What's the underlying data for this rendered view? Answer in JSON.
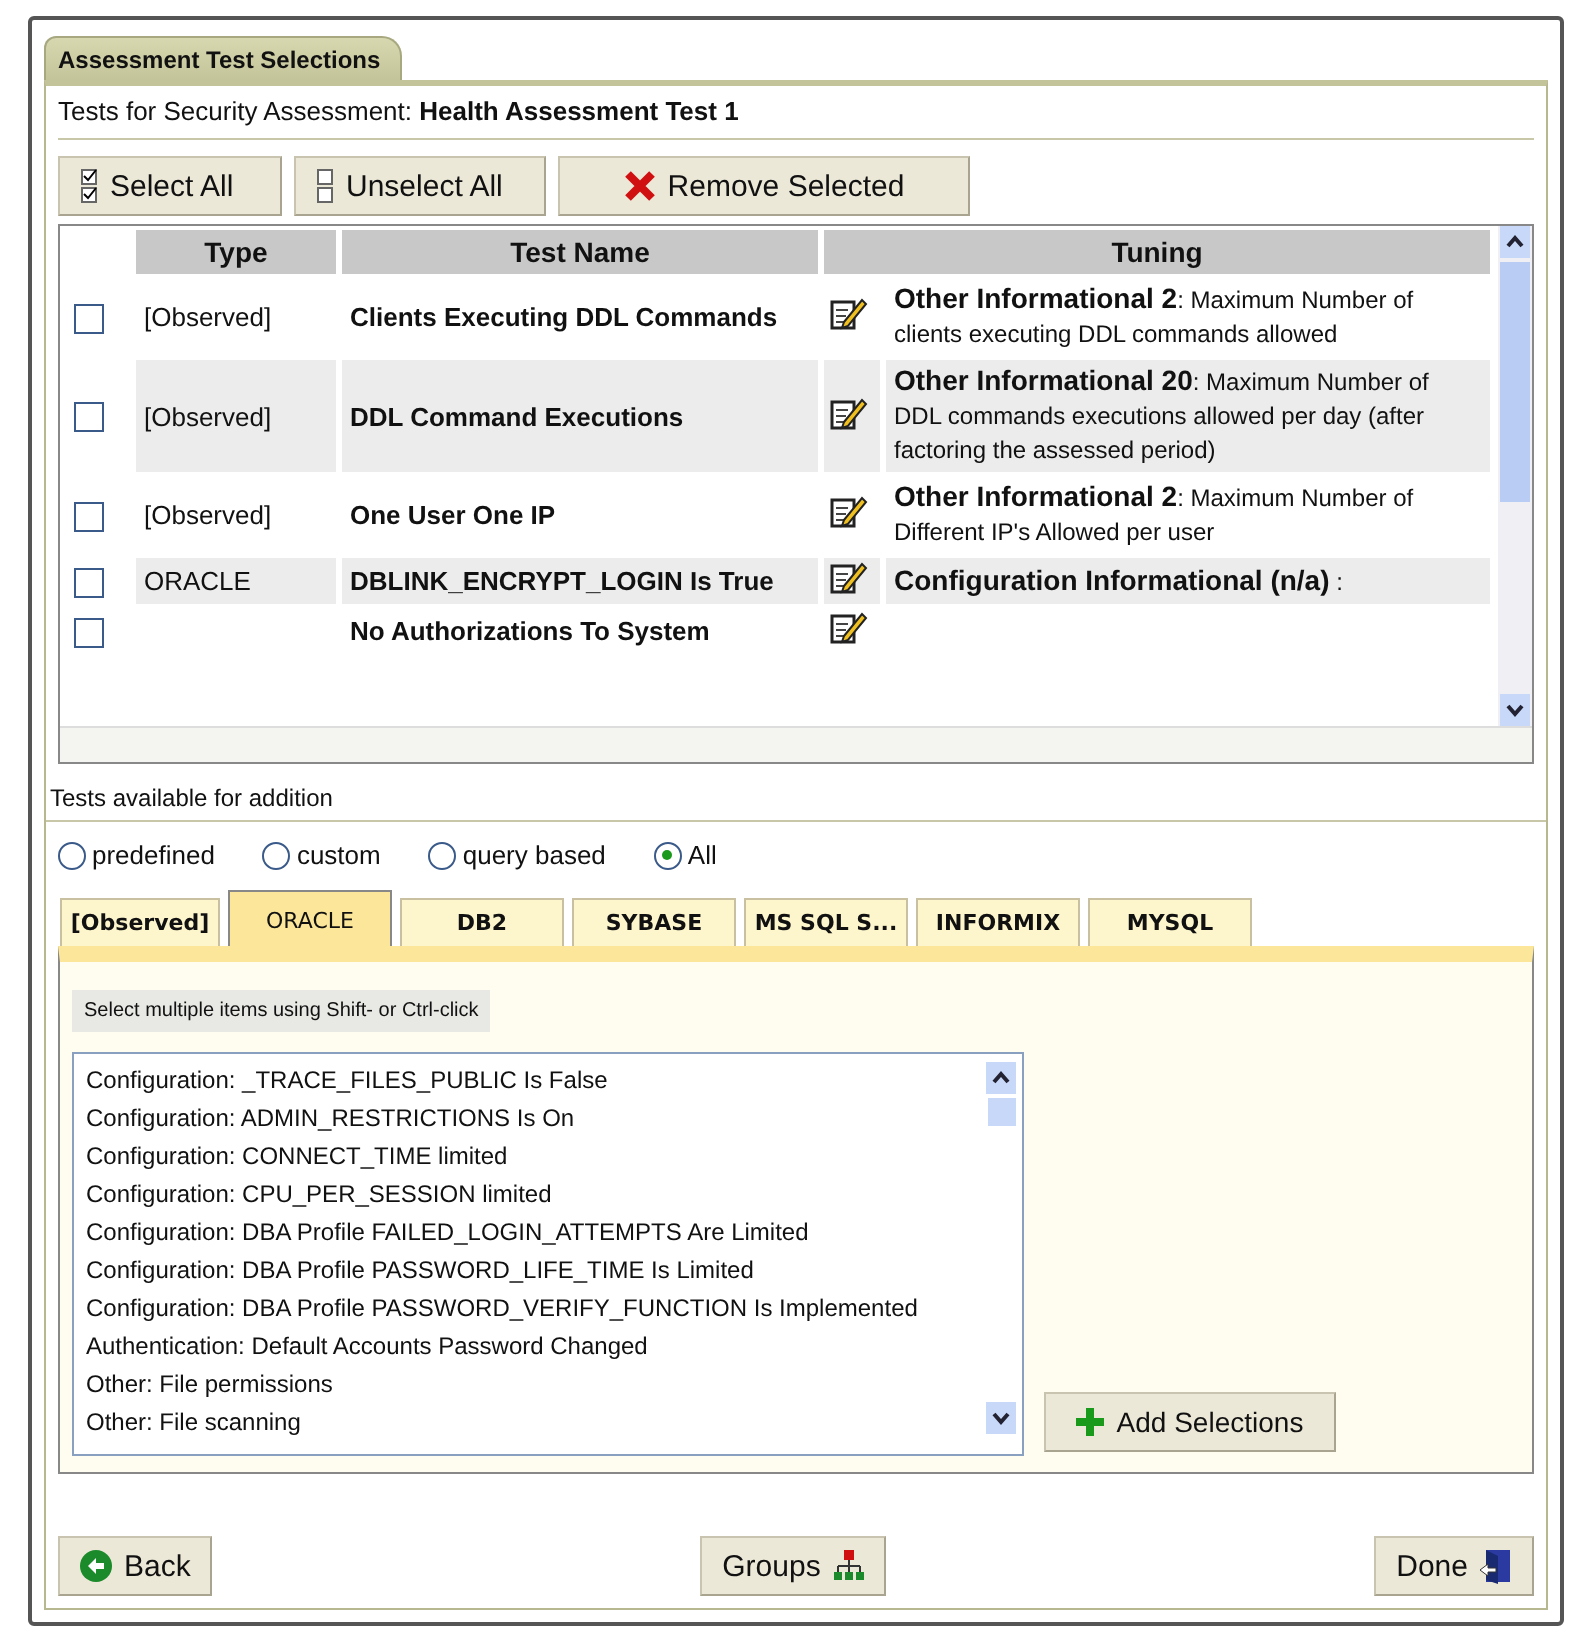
{
  "panel_tab": "Assessment Test Selections",
  "assessment": {
    "label": "Tests for Security Assessment:",
    "name": "Health Assessment Test 1"
  },
  "toolbar": [
    {
      "kind": "select",
      "label": "Select All"
    },
    {
      "kind": "unselect",
      "label": "Unselect All"
    },
    {
      "kind": "remove",
      "label": "Remove Selected"
    }
  ],
  "table": {
    "columns": [
      "Type",
      "Test Name",
      "Tuning"
    ],
    "rows": [
      {
        "checked": false,
        "type": "[Observed]",
        "test_name": "Clients Executing DDL Commands",
        "tuning": "**Other Informational 2**: Maximum Number of clients executing DDL commands allowed"
      },
      {
        "checked": false,
        "type": "[Observed]",
        "test_name": "DDL Command Executions",
        "tuning": "**Other Informational 20**: Maximum Number of DDL commands executions allowed per day (after factoring the assessed period)"
      },
      {
        "checked": false,
        "type": "[Observed]",
        "test_name": "One User One IP",
        "tuning": "**Other Informational 2**: Maximum Number of Different IP's Allowed per user"
      },
      {
        "checked": false,
        "type": "ORACLE",
        "test_name": "DBLINK_ENCRYPT_LOGIN Is True",
        "tuning": "**Configuration Informational (n/a)** :"
      },
      {
        "checked": false,
        "type": "",
        "test_name": "No Authorizations To System",
        "tuning": ""
      }
    ]
  },
  "available": {
    "title": "Tests available for addition",
    "filters": [
      {
        "label": "predefined",
        "selected": false
      },
      {
        "label": "custom",
        "selected": false
      },
      {
        "label": "query based",
        "selected": false
      },
      {
        "label": "All",
        "selected": true
      }
    ],
    "tabs": [
      {
        "label": "[Observed]",
        "selected": false
      },
      {
        "label": "ORACLE",
        "selected": true
      },
      {
        "label": "DB2",
        "selected": false
      },
      {
        "label": "SYBASE",
        "selected": false
      },
      {
        "label": "MS SQL S...",
        "selected": false
      },
      {
        "label": "INFORMIX",
        "selected": false
      },
      {
        "label": "MYSQL",
        "selected": false
      }
    ],
    "hint": "Select multiple items using Shift- or Ctrl-click",
    "items": [
      "Configuration: _TRACE_FILES_PUBLIC Is False",
      "Configuration: ADMIN_RESTRICTIONS Is On",
      "Configuration: CONNECT_TIME limited",
      "Configuration: CPU_PER_SESSION limited",
      "Configuration: DBA Profile FAILED_LOGIN_ATTEMPTS Are Limited",
      "Configuration: DBA Profile PASSWORD_LIFE_TIME Is Limited",
      "Configuration: DBA Profile PASSWORD_VERIFY_FUNCTION Is Implemented",
      "Authentication: Default Accounts Password Changed",
      "Other: File permissions",
      "Other: File scanning"
    ],
    "add_button": "Add Selections"
  },
  "footer": [
    {
      "kind": "back",
      "label": "Back"
    },
    {
      "kind": "groups",
      "label": "Groups"
    },
    {
      "kind": "done",
      "label": "Done"
    }
  ]
}
